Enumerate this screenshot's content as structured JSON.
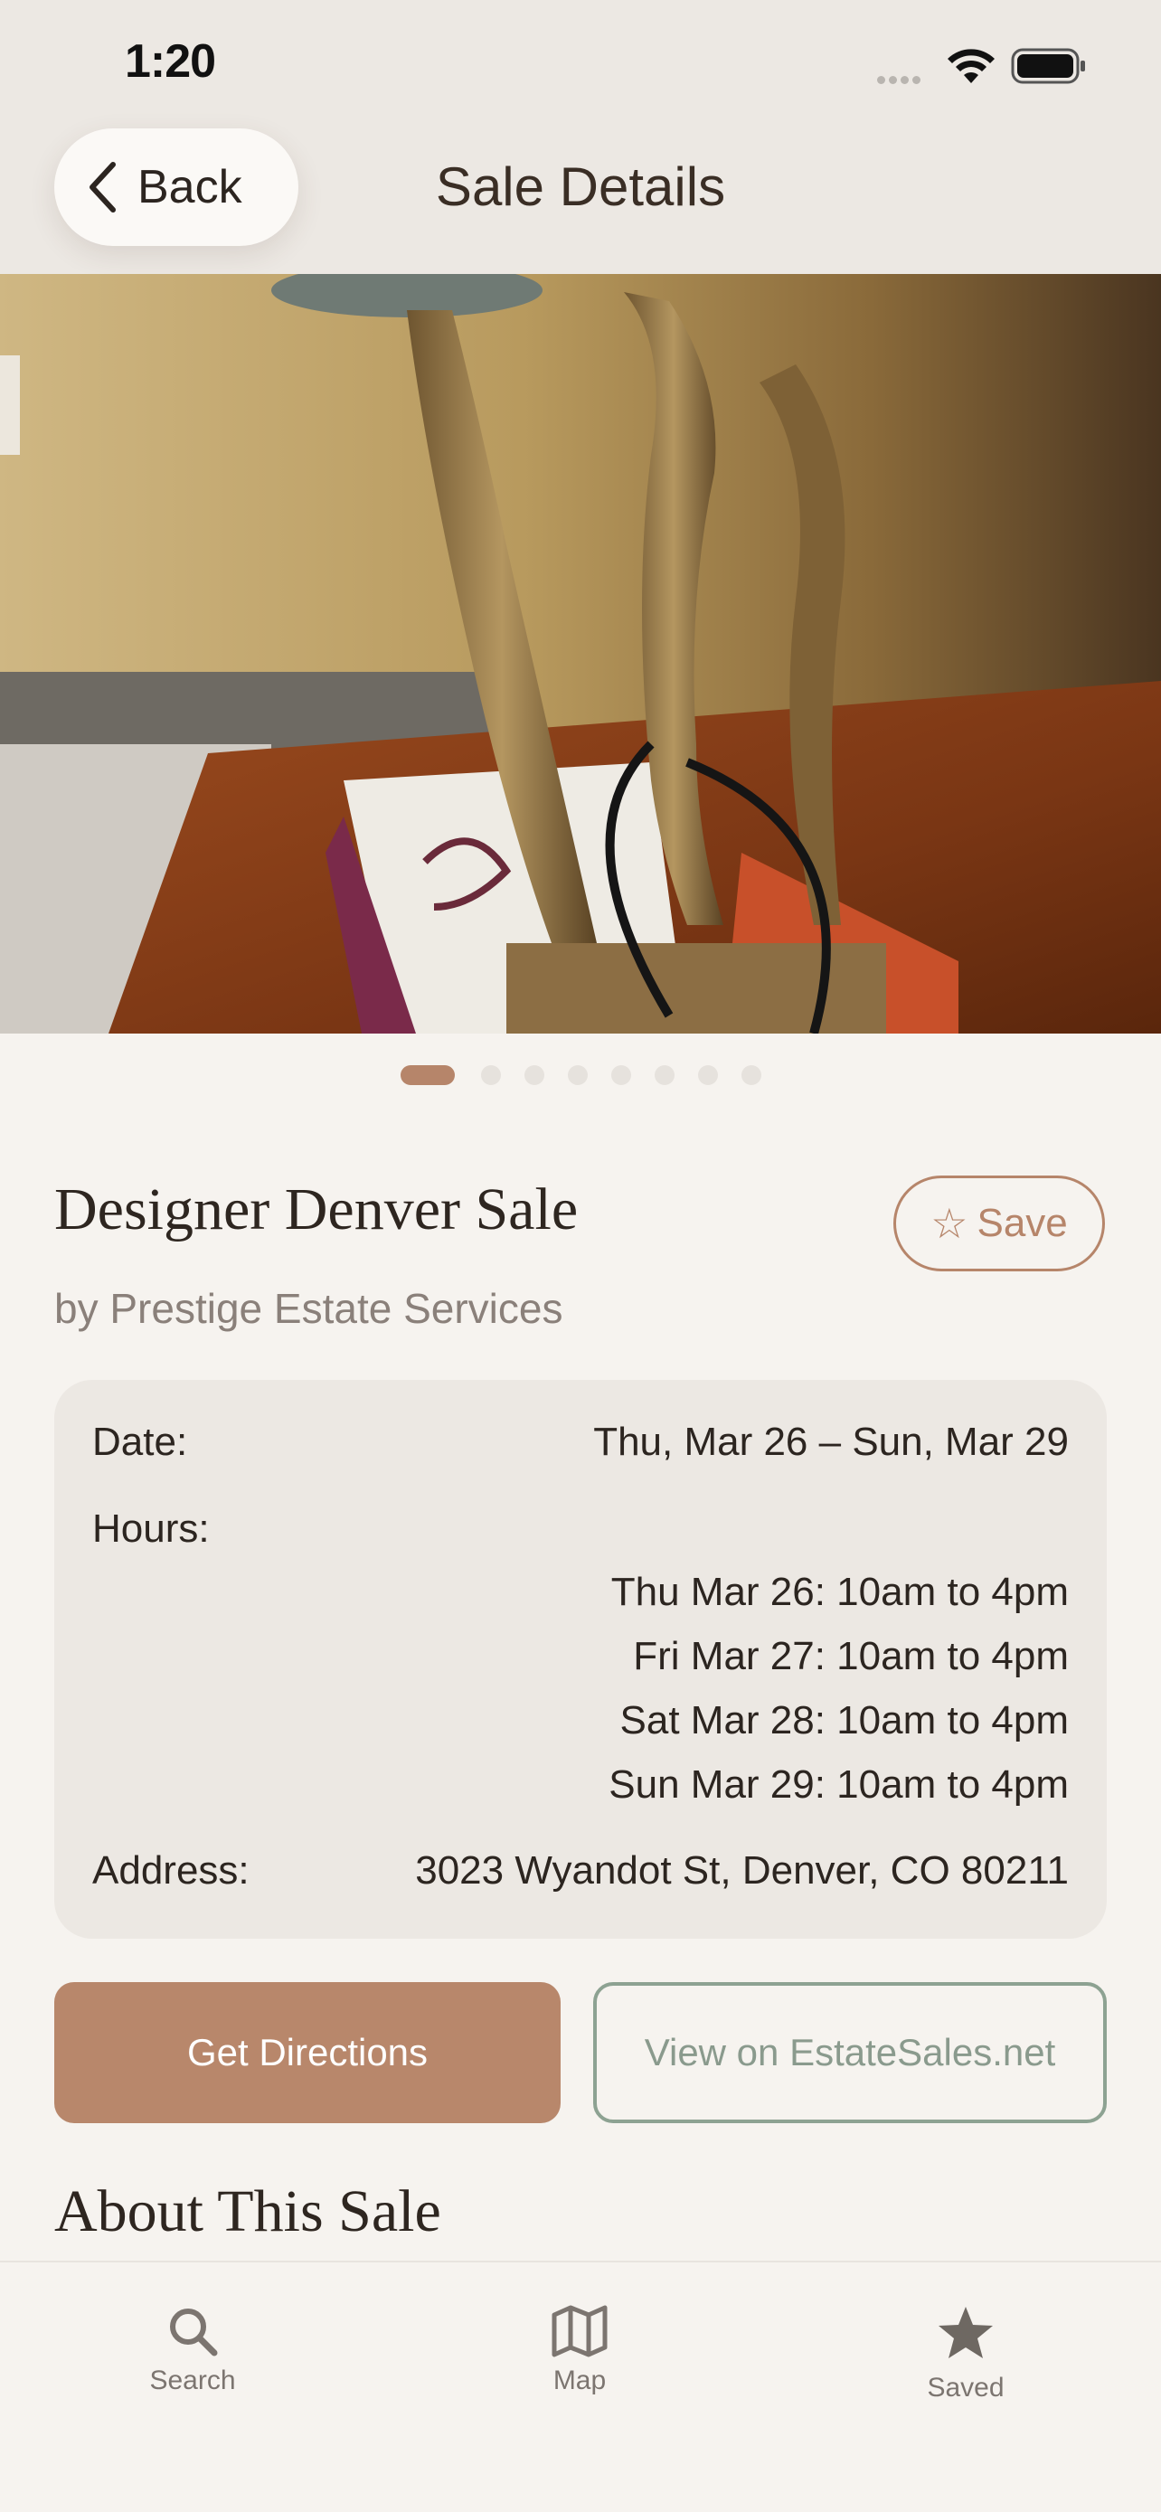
{
  "status_bar": {
    "time": "1:20"
  },
  "header": {
    "back_label": "Back",
    "title": "Sale Details"
  },
  "gallery": {
    "total_photos": 8,
    "active_index": 0
  },
  "sale": {
    "title": "Designer Denver Sale",
    "organizer": "by Prestige Estate Services",
    "save_label": "Save"
  },
  "details": {
    "date_label": "Date:",
    "date_value": "Thu, Mar 26 – Sun, Mar 29",
    "hours_label": "Hours:",
    "hours": [
      "Thu Mar 26: 10am to 4pm",
      "Fri Mar 27: 10am to 4pm",
      "Sat Mar 28: 10am to 4pm",
      "Sun Mar 29: 10am to 4pm"
    ],
    "address_label": "Address:",
    "address_value": "3023 Wyandot St, Denver, CO 80211"
  },
  "actions": {
    "directions_label": "Get Directions",
    "view_label": "View on EstateSales.net"
  },
  "about": {
    "heading": "About This Sale"
  },
  "tabbar": {
    "search_label": "Search",
    "map_label": "Map",
    "saved_label": "Saved"
  },
  "colors": {
    "accent": "#b8876b",
    "secondary": "#8da292",
    "background": "#f6f3ef",
    "card": "#ece8e3"
  }
}
